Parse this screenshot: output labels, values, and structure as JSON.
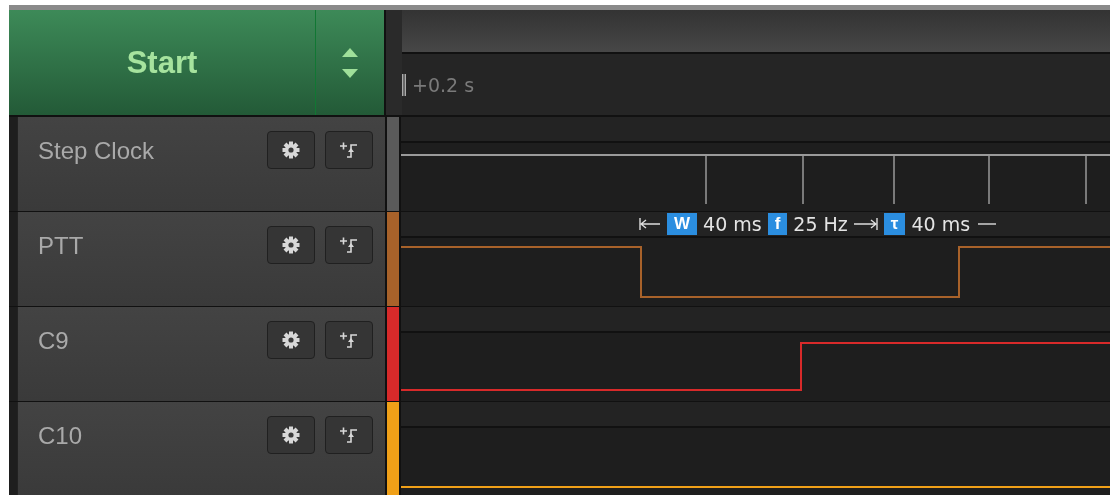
{
  "start_button": {
    "label": "Start"
  },
  "time_ruler": {
    "label": "+0.2 s"
  },
  "channels": [
    {
      "name": "Step Clock",
      "color": "#5a5a5a"
    },
    {
      "name": "PTT",
      "color": "#a8622a",
      "measurements": [
        {
          "symbol": "W",
          "value": "40 ms"
        },
        {
          "symbol": "f",
          "value": "25 Hz"
        },
        {
          "symbol": "τ",
          "value": "40 ms"
        }
      ]
    },
    {
      "name": "C9",
      "color": "#d82a2a"
    },
    {
      "name": "C10",
      "color": "#f0a018"
    }
  ]
}
